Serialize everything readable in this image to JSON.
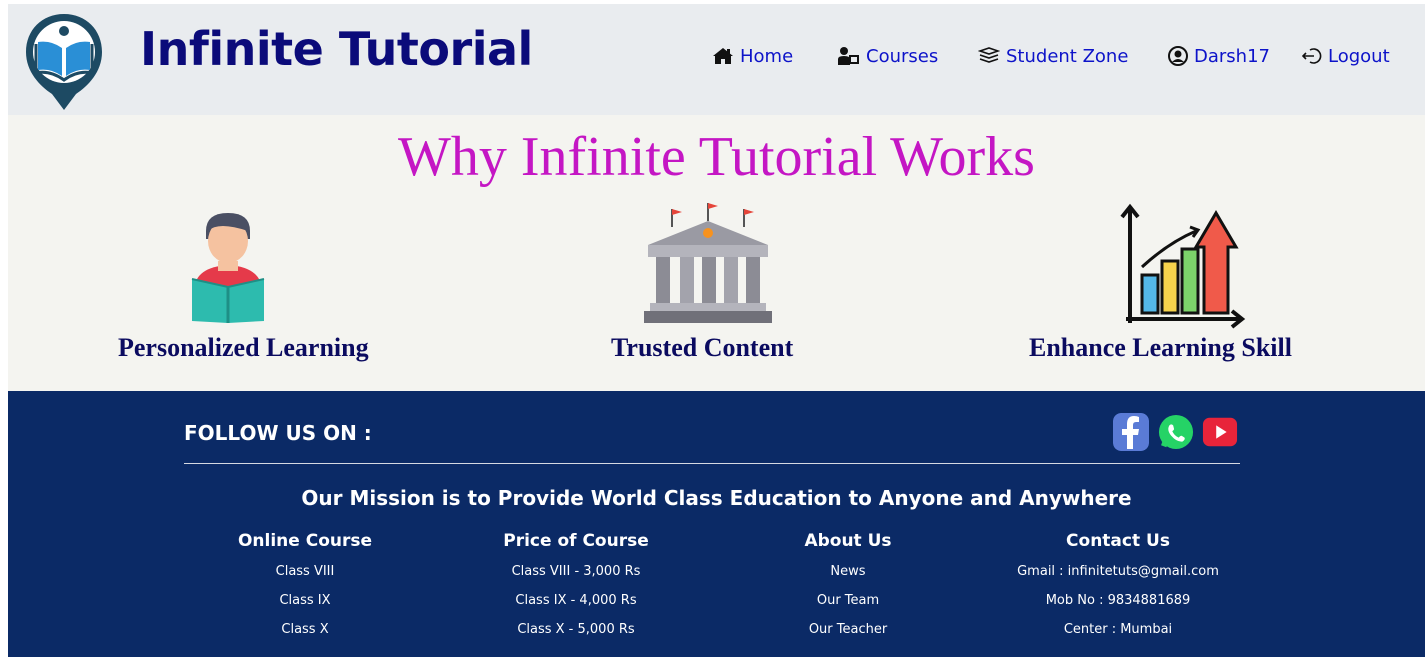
{
  "brand": "Infinite Tutorial",
  "nav": {
    "home": "Home",
    "courses": "Courses",
    "student_zone": "Student Zone",
    "user": "Darsh17",
    "logout": "Logout"
  },
  "features": {
    "title": "Why Infinite Tutorial Works",
    "items": [
      {
        "label": "Personalized Learning",
        "icon": "student-reading-icon"
      },
      {
        "label": "Trusted Content",
        "icon": "institution-building-icon"
      },
      {
        "label": "Enhance Learning Skill",
        "icon": "growth-chart-icon"
      }
    ]
  },
  "footer": {
    "follow": "FOLLOW US ON :",
    "social": [
      "facebook-icon",
      "whatsapp-icon",
      "youtube-icon"
    ],
    "mission": "Our Mission is to Provide World Class Education to Anyone and Anywhere",
    "columns": [
      {
        "title": "Online Course",
        "items": [
          "Class VIII",
          "Class IX",
          "Class X"
        ]
      },
      {
        "title": "Price of Course",
        "items": [
          "Class VIII - 3,000 Rs",
          "Class IX - 4,000 Rs",
          "Class X - 5,000 Rs"
        ]
      },
      {
        "title": "About Us",
        "items": [
          "News",
          "Our Team",
          "Our Teacher"
        ]
      },
      {
        "title": "Contact Us",
        "items": [
          "Gmail : infinitetuts@gmail.com",
          "Mob No : 9834881689",
          "Center : Mumbai"
        ]
      }
    ]
  },
  "colors": {
    "nav_bg": "#e9ecef",
    "brand": "#0b0b7a",
    "nav_link": "#0d13c9",
    "title": "#c416c4",
    "footer_bg": "#0b2a66"
  }
}
